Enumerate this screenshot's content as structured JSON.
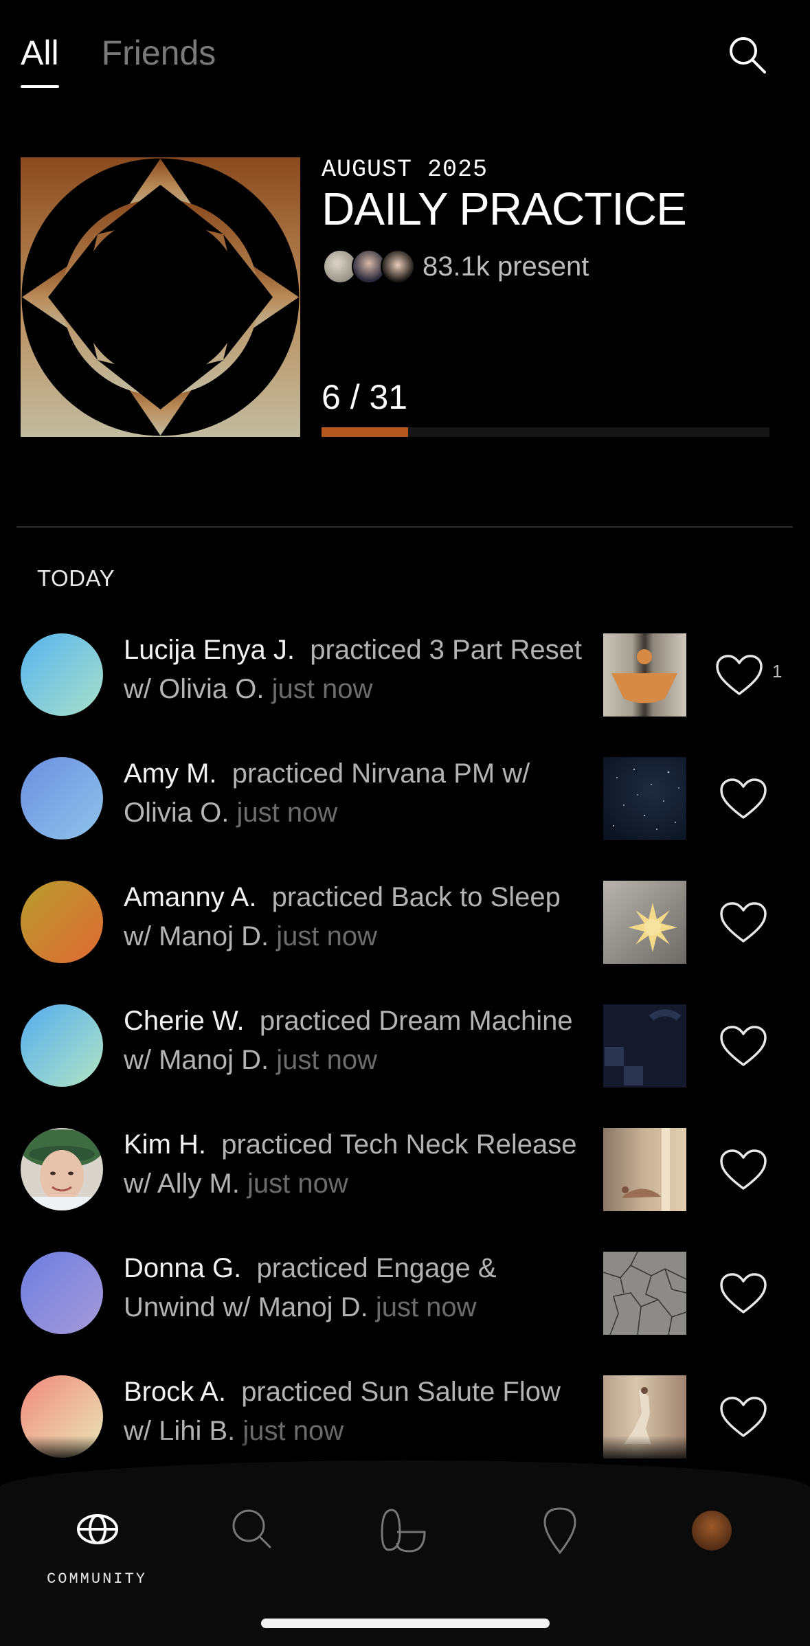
{
  "tabs": {
    "all": "All",
    "friends": "Friends",
    "active": "All"
  },
  "daily_practice": {
    "month": "AUGUST 2025",
    "title": "DAILY PRACTICE",
    "present": "83.1k present",
    "progress_text": "6 / 31",
    "progress_fraction": 0.1935,
    "accent_color": "#b4581f"
  },
  "feed": {
    "section_label": "TODAY",
    "items": [
      {
        "name": "Lucija Enya J.",
        "action": "practiced 3 Part Reset w/ Olivia O.",
        "time": "just now",
        "likes": "1",
        "avatar_colors": [
          "#57b3ef",
          "#a9e1c8"
        ]
      },
      {
        "name": "Amy M.",
        "action": "practiced Nirvana PM w/ Olivia O.",
        "time": "just now",
        "likes": "",
        "avatar_colors": [
          "#6b8fe0",
          "#8fc4ea"
        ]
      },
      {
        "name": "Amanny A.",
        "action": "practiced Back to Sleep w/ Manoj D.",
        "time": "just now",
        "likes": "",
        "avatar_colors": [
          "#b69c2d",
          "#e06a35"
        ]
      },
      {
        "name": "Cherie W.",
        "action": "practiced Dream Machine w/ Manoj D.",
        "time": "just now",
        "likes": "",
        "avatar_colors": [
          "#55adf0",
          "#b2e5c2"
        ]
      },
      {
        "name": "Kim H.",
        "action": "practiced Tech Neck Release w/ Ally M.",
        "time": "just now",
        "likes": "",
        "avatar_colors": [
          "#6c8a4a",
          "#d9b9a5"
        ]
      },
      {
        "name": "Donna G.",
        "action": "practiced Engage & Unwind w/ Manoj D.",
        "time": "just now",
        "likes": "",
        "avatar_colors": [
          "#6e7ee0",
          "#a79ad9"
        ]
      },
      {
        "name": "Brock A.",
        "action": "practiced Sun Salute Flow w/ Lihi B.",
        "time": "just now",
        "likes": "",
        "avatar_colors": [
          "#f08a7d",
          "#e9e7b8"
        ]
      }
    ]
  },
  "bottom_nav": {
    "active_label": "COMMUNITY",
    "items": [
      "globe-icon",
      "search-icon",
      "practice-icon",
      "location-pin-icon",
      "profile-avatar"
    ]
  }
}
